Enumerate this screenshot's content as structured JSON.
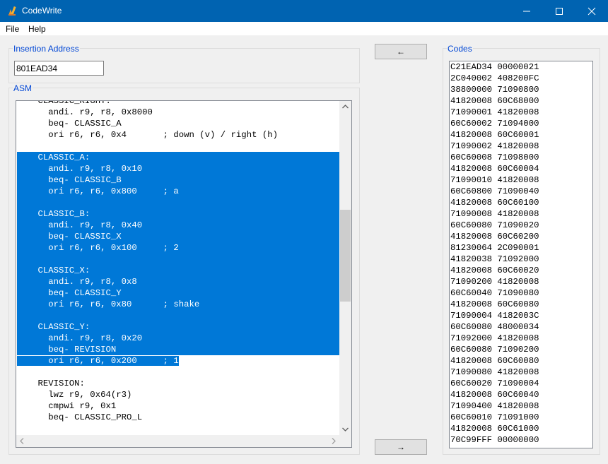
{
  "window": {
    "title": "CodeWrite"
  },
  "menu": {
    "file": "File",
    "help": "Help"
  },
  "insertion": {
    "label": "Insertion Address",
    "value": "801EAD34"
  },
  "asm": {
    "label": "ASM",
    "lines": [
      {
        "text": "    CLASSIC_RIGHT:",
        "sel": "none"
      },
      {
        "text": "      andi. r9, r8, 0x8000",
        "sel": "none"
      },
      {
        "text": "      beq- CLASSIC_A",
        "sel": "none"
      },
      {
        "text": "      ori r6, r6, 0x4       ; down (v) / right (h)",
        "sel": "none"
      },
      {
        "text": "",
        "sel": "none"
      },
      {
        "text": "    CLASSIC_A:",
        "sel": "full"
      },
      {
        "text": "      andi. r9, r8, 0x10",
        "sel": "full"
      },
      {
        "text": "      beq- CLASSIC_B",
        "sel": "full"
      },
      {
        "text": "      ori r6, r6, 0x800     ; a",
        "sel": "full"
      },
      {
        "text": "",
        "sel": "full"
      },
      {
        "text": "    CLASSIC_B:",
        "sel": "full"
      },
      {
        "text": "      andi. r9, r8, 0x40",
        "sel": "full"
      },
      {
        "text": "      beq- CLASSIC_X",
        "sel": "full"
      },
      {
        "text": "      ori r6, r6, 0x100     ; 2",
        "sel": "full"
      },
      {
        "text": "",
        "sel": "full"
      },
      {
        "text": "    CLASSIC_X:",
        "sel": "full"
      },
      {
        "text": "      andi. r9, r8, 0x8",
        "sel": "full"
      },
      {
        "text": "      beq- CLASSIC_Y",
        "sel": "full"
      },
      {
        "text": "      ori r6, r6, 0x80      ; shake",
        "sel": "full"
      },
      {
        "text": "",
        "sel": "full"
      },
      {
        "text": "    CLASSIC_Y:",
        "sel": "full"
      },
      {
        "text": "      andi. r9, r8, 0x20",
        "sel": "full"
      },
      {
        "text": "      beq- REVISION",
        "sel": "full"
      },
      {
        "text": "      ori r6, r6, 0x200     ; 1",
        "sel": "partial"
      },
      {
        "text": "",
        "sel": "none"
      },
      {
        "text": "    REVISION:",
        "sel": "none"
      },
      {
        "text": "      lwz r9, 0x64(r3)",
        "sel": "none"
      },
      {
        "text": "      cmpwi r9, 0x1",
        "sel": "none"
      },
      {
        "text": "      beq- CLASSIC_PRO_L",
        "sel": "none"
      },
      {
        "text": "",
        "sel": "none"
      }
    ]
  },
  "buttons": {
    "to_asm": "←",
    "to_codes": "→"
  },
  "codes": {
    "label": "Codes",
    "lines": [
      "C21EAD34 00000021",
      "2C040002 408200FC",
      "38800000 71090800",
      "41820008 60C68000",
      "71090001 41820008",
      "60C60002 71094000",
      "41820008 60C60001",
      "71090002 41820008",
      "60C60008 71098000",
      "41820008 60C60004",
      "71090010 41820008",
      "60C60800 71090040",
      "41820008 60C60100",
      "71090008 41820008",
      "60C60080 71090020",
      "41820008 60C60200",
      "81230064 2C090001",
      "41820038 71092000",
      "41820008 60C60020",
      "71090200 41820008",
      "60C60040 71090080",
      "41820008 60C60080",
      "71090004 4182003C",
      "60C60080 48000034",
      "71092000 41820008",
      "60C60080 71090200",
      "41820008 60C60080",
      "71090080 41820008",
      "60C60020 71090004",
      "41820008 60C60040",
      "71090400 41820008",
      "60C60010 71091000",
      "41820008 60C61000",
      "70C99FFF 00000000"
    ]
  },
  "colors": {
    "titlebar": "#0063b1",
    "selection": "#0078d7",
    "group_label": "#0046d5"
  }
}
